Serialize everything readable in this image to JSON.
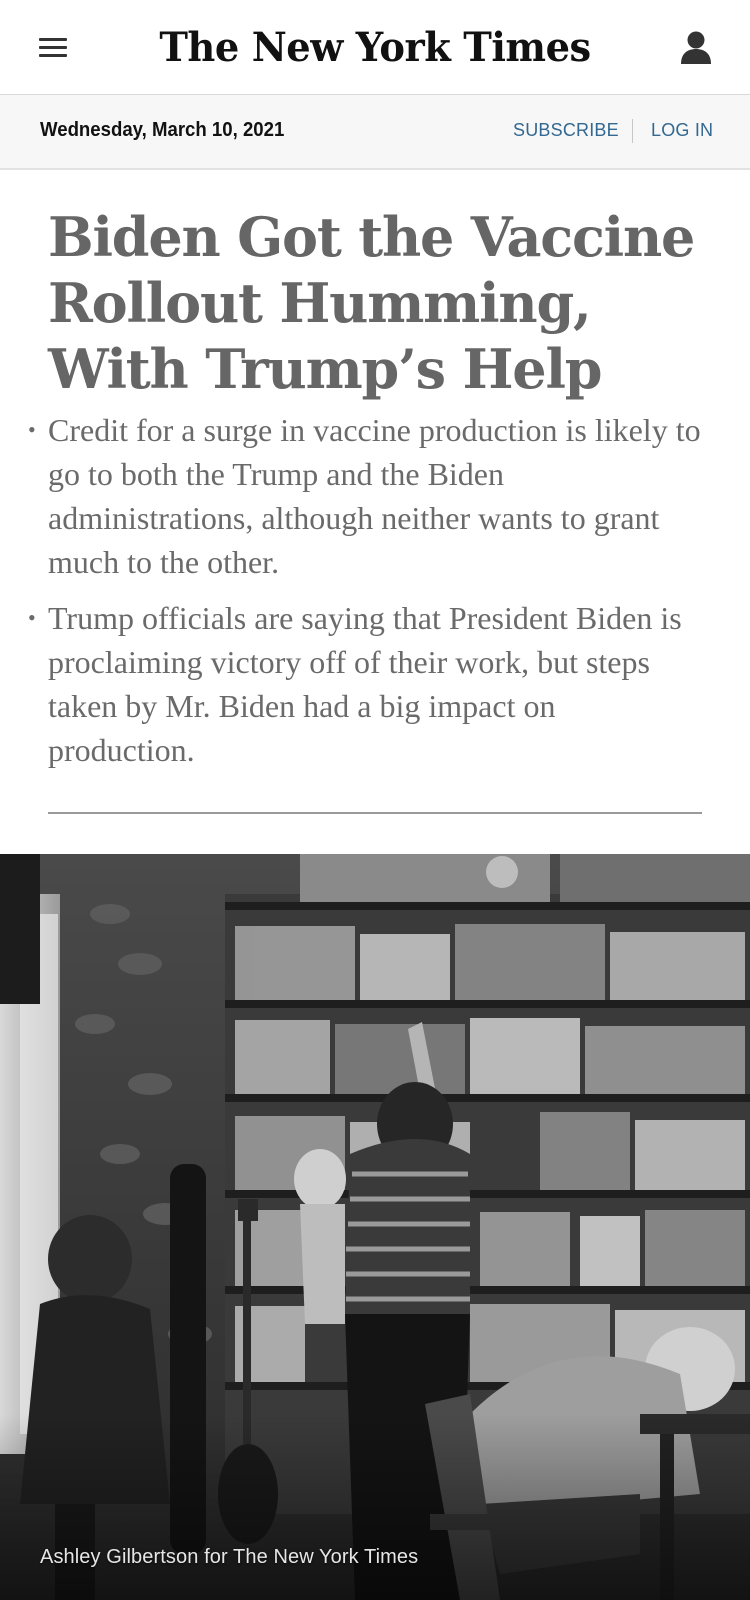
{
  "header": {
    "logo_text": "The New York Times",
    "menu_icon": "hamburger-menu-icon",
    "account_icon": "user-account-icon"
  },
  "datebar": {
    "date": "Wednesday, March 10, 2021",
    "subscribe_label": "SUBSCRIBE",
    "login_label": "LOG IN"
  },
  "article": {
    "headline": "Biden Got the Vaccine Rollout Humming, With Trump’s Help",
    "summary": [
      "Credit for a surge in vaccine production is likely to go to both the Trump and the Biden administrations, although neither wants to grant much to the other.",
      "Trump officials are saying that President Biden is proclaiming victory off of their work, but steps taken by Mr. Biden had a big impact on production."
    ],
    "photo_credit": "Ashley Gilbertson for The New York Times"
  },
  "colors": {
    "link_blue": "#326891",
    "headline_gray": "#666666",
    "datebar_bg": "#f7f7f7"
  }
}
